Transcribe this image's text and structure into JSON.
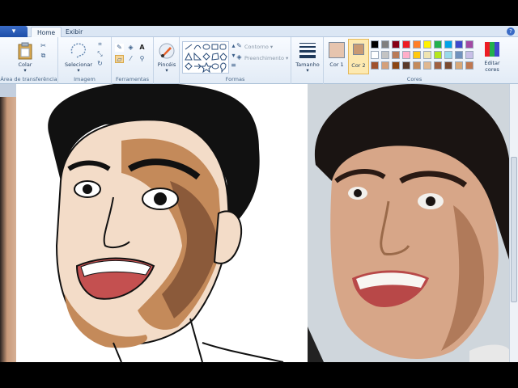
{
  "app_menu": {
    "label": "▾"
  },
  "tabs": [
    {
      "label": "Home",
      "active": true
    },
    {
      "label": "Exibir",
      "active": false
    }
  ],
  "ribbon": {
    "clipboard": {
      "group_label": "Área de transferência",
      "paste_label": "Colar"
    },
    "image": {
      "group_label": "Imagem",
      "select_label": "Selecionar"
    },
    "tools": {
      "group_label": "Ferramentas"
    },
    "brushes": {
      "label": "Pincéis"
    },
    "shapes": {
      "group_label": "Formas",
      "outline_label": "Contorno ▾",
      "fill_label": "Preenchimento ▾"
    },
    "size": {
      "label": "Tamanho"
    },
    "colors": {
      "group_label": "Cores",
      "color1_label": "Cor 1",
      "color2_label": "Cor 2",
      "edit_label": "Editar cores",
      "color1": "#e6c4ae",
      "color2": "#c99a73",
      "palette": [
        [
          "#000000",
          "#7f7f7f",
          "#880015",
          "#ed1c24",
          "#ff7f27",
          "#fff200",
          "#22b14c",
          "#00a2e8",
          "#3f48cc",
          "#a349a4"
        ],
        [
          "#ffffff",
          "#c3c3c3",
          "#b97a57",
          "#ffaec9",
          "#ffc90e",
          "#efe4b0",
          "#b5e61d",
          "#99d9ea",
          "#7092be",
          "#c8bfe7"
        ],
        [
          "#a0522d",
          "#d4a07a",
          "#8b4513",
          "#5a3a2a",
          "#c48a5a",
          "#e0b890",
          "#a06040",
          "#7a4a30",
          "#d8a878",
          "#c07850"
        ]
      ]
    }
  }
}
